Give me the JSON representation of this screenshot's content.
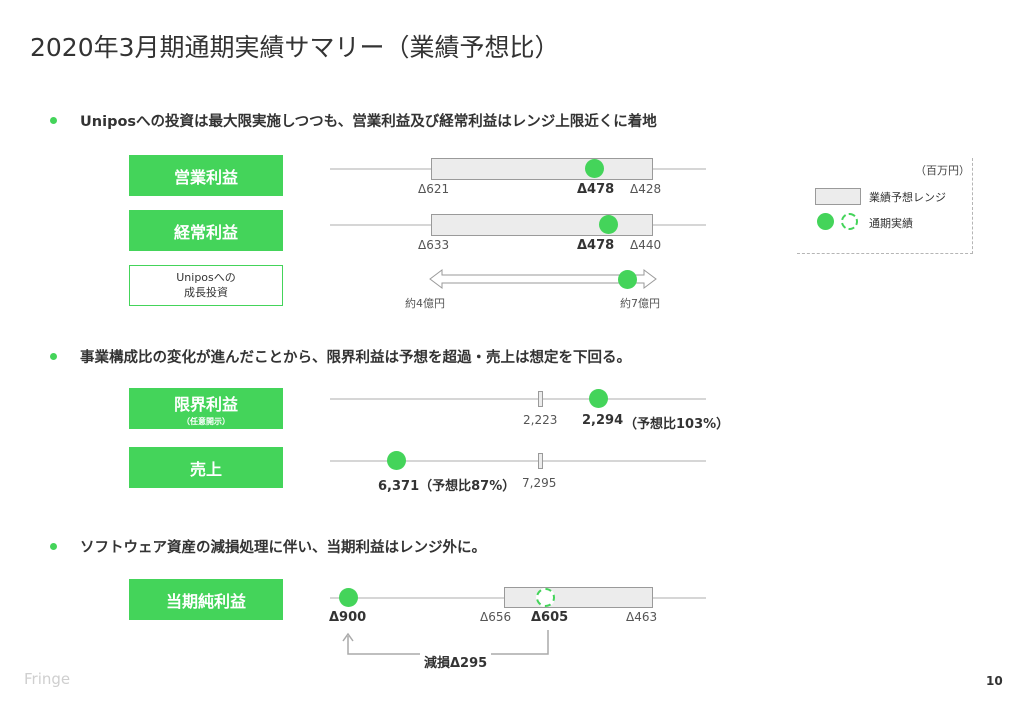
{
  "title": "2020年3月期通期実績サマリー（業績予想比）",
  "bullets": [
    "Uniposへの投資は最大限実施しつつも、営業利益及び経常利益はレンジ上限近くに着地",
    "事業構成比の変化が進んだことから、限界利益は予想を超過・売上は想定を下回る。",
    "ソフトウェア資産の減損処理に伴い、当期利益はレンジ外に。"
  ],
  "rows": {
    "operating_profit": {
      "label": "営業利益",
      "range_low": "Δ621",
      "actual": "Δ478",
      "range_high": "Δ428"
    },
    "ordinary_profit": {
      "label": "経常利益",
      "range_low": "Δ633",
      "actual": "Δ478",
      "range_high": "Δ440"
    },
    "unipos": {
      "label_line1": "Uniposへの",
      "label_line2": "成長投資",
      "from": "約4億円",
      "to": "約7億円"
    },
    "marginal_profit": {
      "label": "限界利益",
      "sub": "（任意開示）",
      "forecast": "2,223",
      "actual": "2,294",
      "ratio": "（予想比103%）"
    },
    "sales": {
      "label": "売上",
      "actual_with_ratio": "6,371（予想比87%）",
      "forecast": "7,295"
    },
    "net_profit": {
      "label": "当期純利益",
      "actual": "Δ900",
      "range_low": "Δ656",
      "forecast": "Δ605",
      "range_high": "Δ463",
      "impairment": "減損Δ295"
    }
  },
  "legend": {
    "unit": "（百万円）",
    "range_label": "業績予想レンジ",
    "actual_label": "通期実績"
  },
  "footer": {
    "brand": "Fringe",
    "page": "10"
  },
  "colors": {
    "accent": "#44d45a",
    "range_fill": "#ececec",
    "range_border": "#9a9a9a",
    "axis": "#d6d6d6"
  }
}
